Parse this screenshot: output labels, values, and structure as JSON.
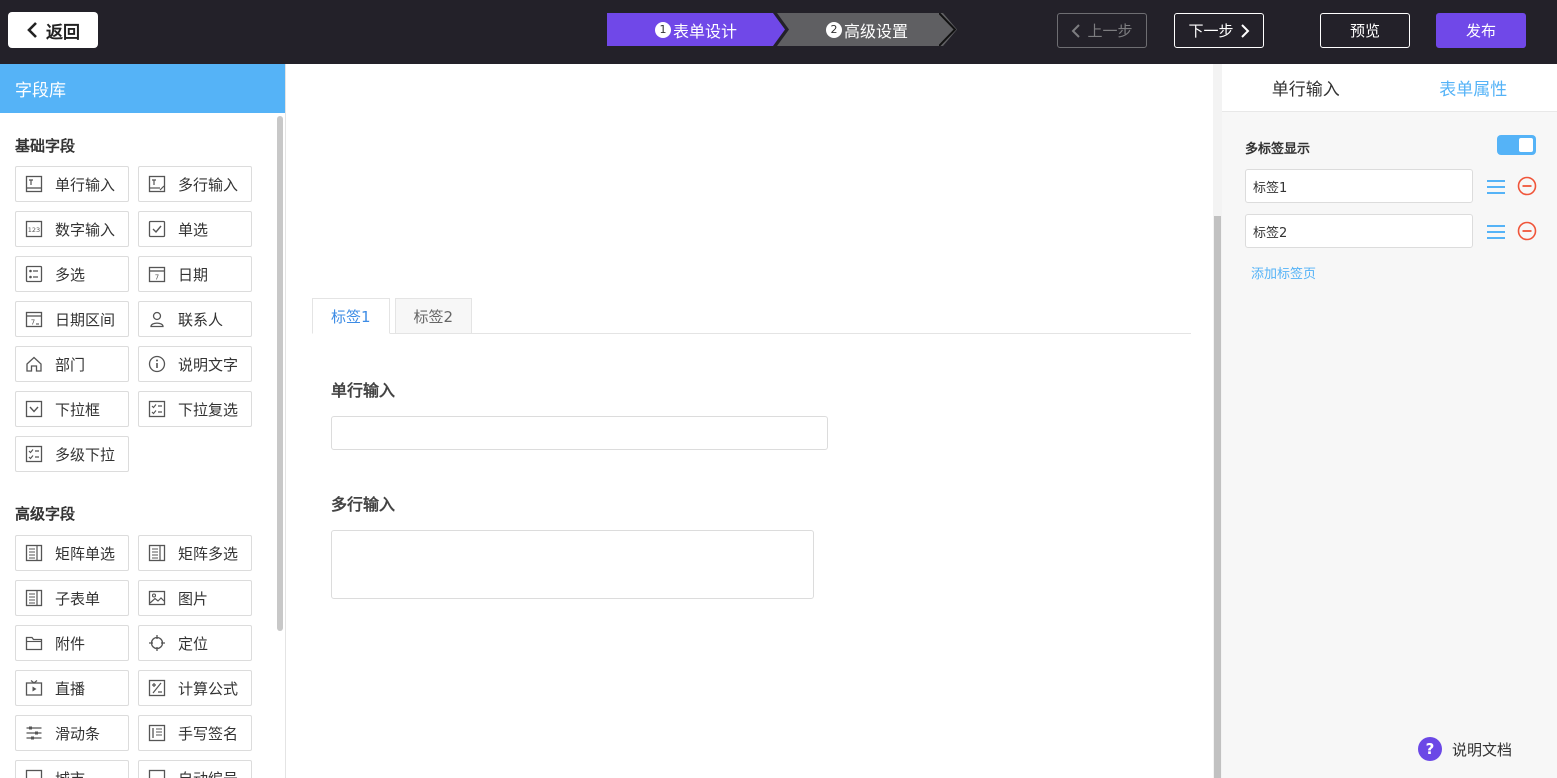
{
  "topbar": {
    "back_label": "返回",
    "steps": [
      {
        "num": "1",
        "label": "表单设计"
      },
      {
        "num": "2",
        "label": "高级设置"
      }
    ],
    "prev_label": "上一步",
    "next_label": "下一步",
    "preview_label": "预览",
    "publish_label": "发布"
  },
  "sidebar": {
    "title": "字段库",
    "basic_title": "基础字段",
    "basic_fields": [
      {
        "label": "单行输入",
        "icon": "text-input-icon"
      },
      {
        "label": "多行输入",
        "icon": "textarea-icon"
      },
      {
        "label": "数字输入",
        "icon": "number-icon"
      },
      {
        "label": "单选",
        "icon": "radio-check-icon"
      },
      {
        "label": "多选",
        "icon": "checkbox-list-icon"
      },
      {
        "label": "日期",
        "icon": "calendar-icon"
      },
      {
        "label": "日期区间",
        "icon": "calendar-range-icon"
      },
      {
        "label": "联系人",
        "icon": "person-icon"
      },
      {
        "label": "部门",
        "icon": "home-icon"
      },
      {
        "label": "说明文字",
        "icon": "info-icon"
      },
      {
        "label": "下拉框",
        "icon": "dropdown-icon"
      },
      {
        "label": "下拉复选",
        "icon": "dropdown-multi-icon"
      },
      {
        "label": "多级下拉",
        "icon": "cascade-icon"
      }
    ],
    "advanced_title": "高级字段",
    "advanced_fields": [
      {
        "label": "矩阵单选",
        "icon": "matrix-radio-icon"
      },
      {
        "label": "矩阵多选",
        "icon": "matrix-check-icon"
      },
      {
        "label": "子表单",
        "icon": "subform-icon"
      },
      {
        "label": "图片",
        "icon": "image-icon"
      },
      {
        "label": "附件",
        "icon": "folder-icon"
      },
      {
        "label": "定位",
        "icon": "crosshair-icon"
      },
      {
        "label": "直播",
        "icon": "tv-icon"
      },
      {
        "label": "计算公式",
        "icon": "formula-icon"
      },
      {
        "label": "滑动条",
        "icon": "slider-icon"
      },
      {
        "label": "手写签名",
        "icon": "signature-icon"
      },
      {
        "label": "城市",
        "icon": "city-icon"
      },
      {
        "label": "自动编号",
        "icon": "auto-number-icon"
      }
    ]
  },
  "canvas": {
    "tabs": [
      "标签1",
      "标签2"
    ],
    "active_tab": 0,
    "fields": [
      {
        "label": "单行输入",
        "value": ""
      },
      {
        "label": "多行输入",
        "value": ""
      }
    ]
  },
  "right_panel": {
    "tabs": [
      "单行输入",
      "表单属性"
    ],
    "active_tab": 1,
    "multi_label_title": "多标签显示",
    "multi_label_enabled": true,
    "tab_values": [
      "标签1",
      "标签2"
    ],
    "add_tab_label": "添加标签页",
    "doc_label": "说明文档",
    "accent_color": "#55b3f7",
    "brand_color": "#7048e8",
    "danger_color": "#f0553a"
  }
}
